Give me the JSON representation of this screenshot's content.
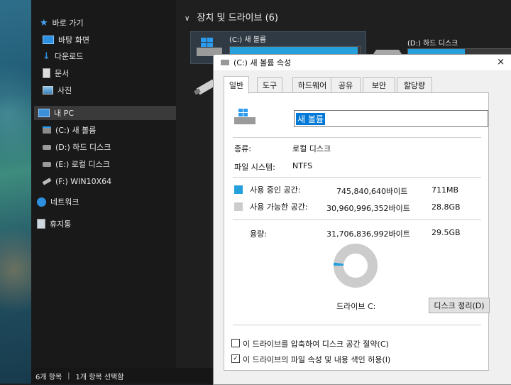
{
  "nav": {
    "quick_access": "바로 가기",
    "items": [
      {
        "label": "바탕 화면"
      },
      {
        "label": "다운로드"
      },
      {
        "label": "문서"
      },
      {
        "label": "사진"
      }
    ],
    "this_pc": "내 PC",
    "drives": [
      {
        "label": "(C:) 새 볼륨"
      },
      {
        "label": "(D:) 하드 디스크"
      },
      {
        "label": "(E:) 로컬 디스크"
      },
      {
        "label": "(F:) WIN10X64"
      }
    ],
    "network": "네트워크",
    "recycle": "휴지통"
  },
  "main": {
    "header": "장치 및 드라이브 (6)",
    "drive_c": {
      "label": "(C:) 새 볼륨",
      "used_fraction": 0.98
    },
    "drive_d": {
      "label": "(D:) 하드 디스크",
      "used_fraction": 0.55
    }
  },
  "status": {
    "count": "6개 항목",
    "selected": "1개 항목 선택함"
  },
  "dialog": {
    "title": "(C:) 새 볼륨 속성",
    "close": "×",
    "tabs": [
      "일반",
      "도구",
      "하드웨어",
      "공유",
      "보안",
      "할당량"
    ],
    "name_value": "새 볼륨",
    "type_label": "종류:",
    "type_value": "로컬 디스크",
    "fs_label": "파일 시스템:",
    "fs_value": "NTFS",
    "used_label": "사용 중인 공간:",
    "used_bytes": "745,840,640바이트",
    "used_size": "711MB",
    "free_label": "사용 가능한 공간:",
    "free_bytes": "30,960,996,352바이트",
    "free_size": "28.8GB",
    "cap_label": "용량:",
    "cap_bytes": "31,706,836,992바이트",
    "cap_size": "29.5GB",
    "used_fraction": 0.0235,
    "drive_caption": "드라이브 C:",
    "cleanup_button": "디스크 정리(D)",
    "compress_label": "이 드라이브를 압축하여 디스크 공간 절약(C)",
    "compress_checked": false,
    "index_label": "이 드라이브의 파일 속성 및 내용 색인 허용(I)",
    "index_checked": true
  },
  "colors": {
    "used": "#26a0da",
    "free": "#cccccc",
    "accent": "#0078d7"
  }
}
